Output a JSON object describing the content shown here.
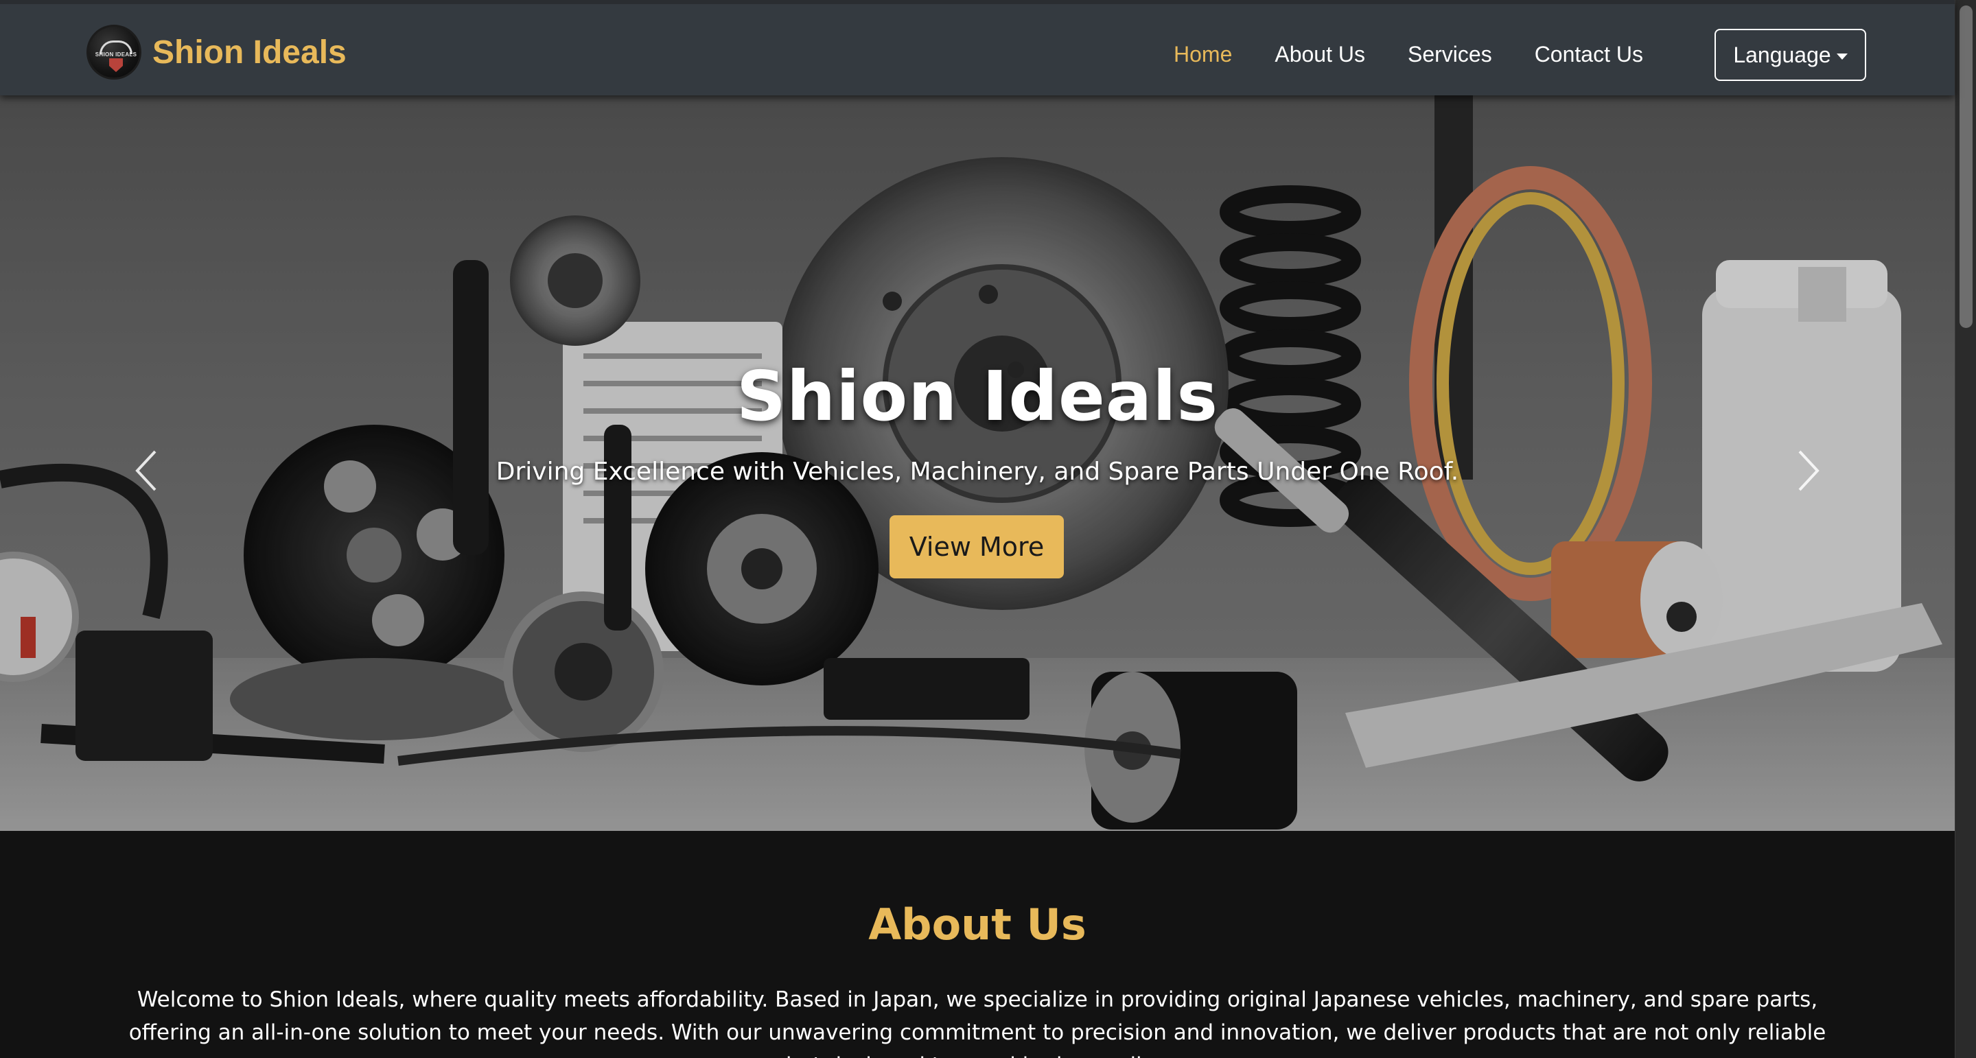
{
  "navbar": {
    "brand_name": "Shion Ideals",
    "logo_text": "SHION IDEALS",
    "links": [
      {
        "label": "Home",
        "active": true
      },
      {
        "label": "About Us",
        "active": false
      },
      {
        "label": "Services",
        "active": false
      },
      {
        "label": "Contact Us",
        "active": false
      }
    ],
    "language_label": "Language"
  },
  "hero": {
    "title": "Shion Ideals",
    "subtitle": "Driving Excellence with Vehicles, Machinery, and Spare Parts Under One Roof.",
    "button_label": "View More",
    "prev_icon": "chevron-left-icon",
    "next_icon": "chevron-right-icon"
  },
  "about": {
    "title": "About Us",
    "text": "Welcome to Shion Ideals, where quality meets affordability. Based in Japan, we specialize in providing original Japanese vehicles, machinery, and spare parts, offering an all-in-one solution to meet your needs. With our unwavering commitment to precision and innovation, we deliver products that are not only reliable but designed to excel in demanding"
  },
  "colors": {
    "accent": "#e8b95a",
    "navbar_bg": "#343a40",
    "page_bg": "#121212"
  }
}
